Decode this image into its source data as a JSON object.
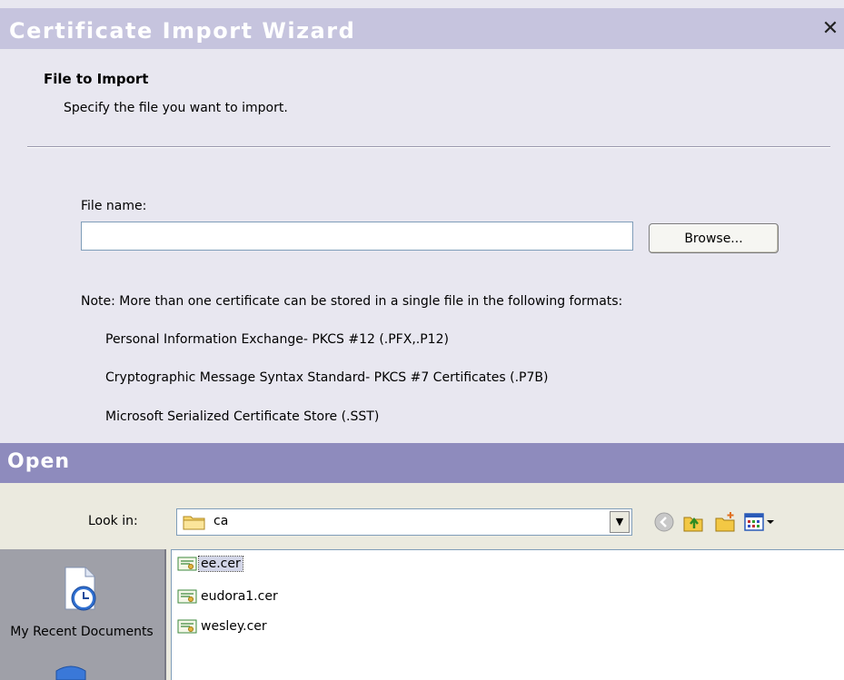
{
  "wizard": {
    "title": "Certificate Import Wizard",
    "close_icon": "close-icon",
    "heading": "File to Import",
    "subheading": "Specify the file you want to import.",
    "file_name_label": "File name:",
    "file_name_value": "",
    "browse_label": "Browse...",
    "note": "Note:  More than one certificate can be stored in a single file in the following formats:",
    "formats": [
      "Personal Information Exchange- PKCS #12 (.PFX,.P12)",
      "Cryptographic Message Syntax Standard- PKCS #7 Certificates (.P7B)",
      "Microsoft Serialized Certificate Store (.SST)"
    ]
  },
  "open_dialog": {
    "title": "Open",
    "look_in_label": "Look in:",
    "look_in_value": "ca",
    "toolbar_icons": [
      "back-icon",
      "up-folder-icon",
      "new-folder-icon",
      "view-menu-icon"
    ],
    "places": [
      {
        "label": "My Recent Documents",
        "icon": "recent-documents-icon"
      }
    ],
    "files": [
      {
        "name": "ee.cer",
        "selected": true
      },
      {
        "name": "eudora1.cer",
        "selected": false
      },
      {
        "name": "wesley.cer",
        "selected": false
      }
    ]
  },
  "colors": {
    "wizard_titlebar": "#c6c4de",
    "open_titlebar": "#8e8bbd",
    "places_bar": "#9fa0a8"
  }
}
